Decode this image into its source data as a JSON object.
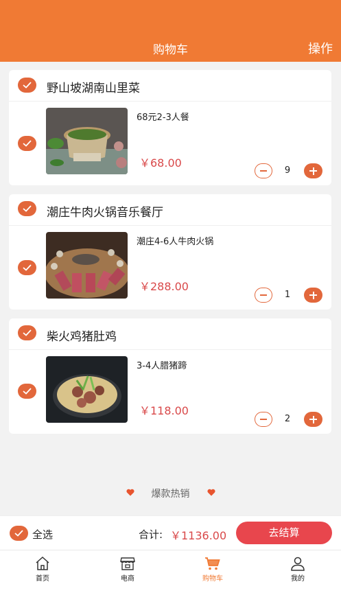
{
  "header": {
    "title": "购物车",
    "action": "操作"
  },
  "cart": [
    {
      "shop": "野山坡湖南山里菜",
      "item": "68元2-3人餐",
      "price": "￥68.00",
      "qty": "9"
    },
    {
      "shop": "潮庄牛肉火锅音乐餐厅",
      "item": "潮庄4-6人牛肉火锅",
      "price": "￥288.00",
      "qty": "1"
    },
    {
      "shop": "柴火鸡猪肚鸡",
      "item": "3-4人腊猪蹄",
      "price": "￥118.00",
      "qty": "2"
    }
  ],
  "hot_section": {
    "label": "爆款热销"
  },
  "summary": {
    "select_all": "全选",
    "total_label": "合计:",
    "total_value": "￥1136.00",
    "checkout": "去结算"
  },
  "tabbar": [
    {
      "label": "首页",
      "icon": "home-icon"
    },
    {
      "label": "电商",
      "icon": "store-icon"
    },
    {
      "label": "购物车",
      "icon": "cart-icon"
    },
    {
      "label": "我的",
      "icon": "user-icon"
    }
  ],
  "colors": {
    "accent": "#f07a34",
    "check": "#e2673b",
    "price": "#d9494a",
    "checkout": "#e8464d"
  }
}
